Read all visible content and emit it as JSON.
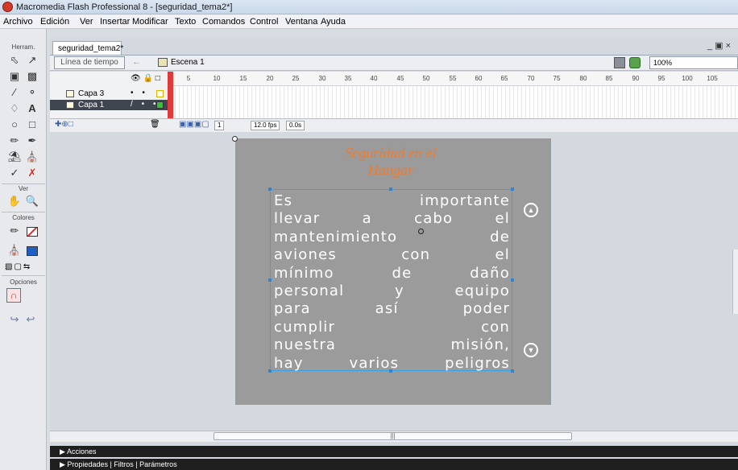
{
  "window": {
    "title": "Macromedia Flash Professional 8 - [seguridad_tema2*]"
  },
  "menu": [
    "Archivo",
    "Edición",
    "Ver",
    "Insertar",
    "Modificar",
    "Texto",
    "Comandos",
    "Control",
    "Ventana",
    "Ayuda"
  ],
  "toolbox": {
    "tools_label": "Herram.",
    "view_label": "Ver",
    "colors_label": "Colores",
    "options_label": "Opciones"
  },
  "document": {
    "tab": "seguridad_tema2*",
    "timeline_button": "Línea de tiempo",
    "scene": "Escena 1",
    "zoom": "100%"
  },
  "timeline": {
    "layers": [
      {
        "name": "Capa 3",
        "selected": false
      },
      {
        "name": "Capa 1",
        "selected": true
      }
    ],
    "frame_numbers": [
      "5",
      "10",
      "15",
      "20",
      "25",
      "30",
      "35",
      "40",
      "45",
      "50",
      "55",
      "60",
      "65",
      "70",
      "75",
      "80",
      "85",
      "90",
      "95",
      "100",
      "105"
    ],
    "current_frame": "1",
    "fps": "12.0 fps",
    "time": "0.0s"
  },
  "stage": {
    "title_line1": "Seguridad en el",
    "title_line2": "Hangar",
    "body_lines": [
      "Es importante",
      "llevar a cabo el",
      "mantenimiento de",
      "aviones con el",
      "mínimo de daño",
      "personal y equipo",
      "para así poder",
      "cumplir con",
      "nuestra misión,",
      "hay varios peligros"
    ]
  },
  "panels": {
    "actions": "Acciones",
    "properties": "Propiedades | Filtros | Parámetros"
  },
  "colors": {
    "title_orange": "#f27b2a",
    "stage_gray": "#9b9b9b",
    "selection_blue": "#39a0e6"
  }
}
